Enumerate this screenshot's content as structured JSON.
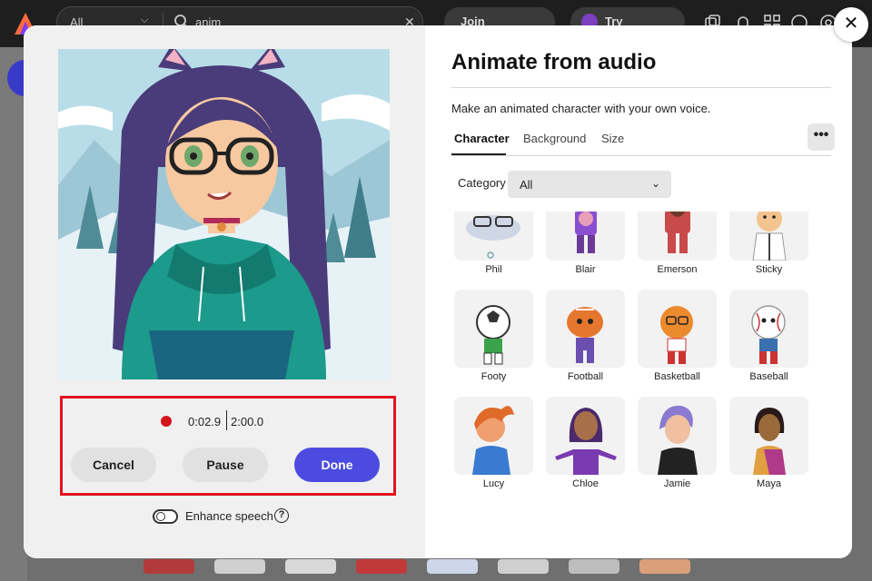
{
  "topbar": {
    "search_scope": "All",
    "search_value": "anim",
    "join_community": "Join community",
    "try_premium": "Try Premium"
  },
  "modal": {
    "title": "Animate from audio",
    "subtitle": "Make an animated character with your own voice.",
    "tabs": [
      {
        "label": "Character",
        "active": true
      },
      {
        "label": "Background",
        "active": false
      },
      {
        "label": "Size",
        "active": false
      }
    ],
    "more_label": "•••",
    "category_label": "Category",
    "category_value": "All",
    "characters": [
      {
        "name": "Phil"
      },
      {
        "name": "Blair"
      },
      {
        "name": "Emerson"
      },
      {
        "name": "Sticky"
      },
      {
        "name": "Footy"
      },
      {
        "name": "Football"
      },
      {
        "name": "Basketball"
      },
      {
        "name": "Baseball"
      },
      {
        "name": "Lucy"
      },
      {
        "name": "Chloe"
      },
      {
        "name": "Jamie"
      },
      {
        "name": "Maya"
      }
    ],
    "recorder": {
      "elapsed": "0:02.9",
      "total": "2:00.0",
      "cancel_label": "Cancel",
      "pause_label": "Pause",
      "done_label": "Done"
    },
    "enhance_speech_label": "Enhance speech",
    "enhance_speech_on": false,
    "help_label": "?",
    "close_label": "✕"
  },
  "colors": {
    "accent": "#4b4be0",
    "record": "#d4141c",
    "highlight": "#e0141e"
  }
}
